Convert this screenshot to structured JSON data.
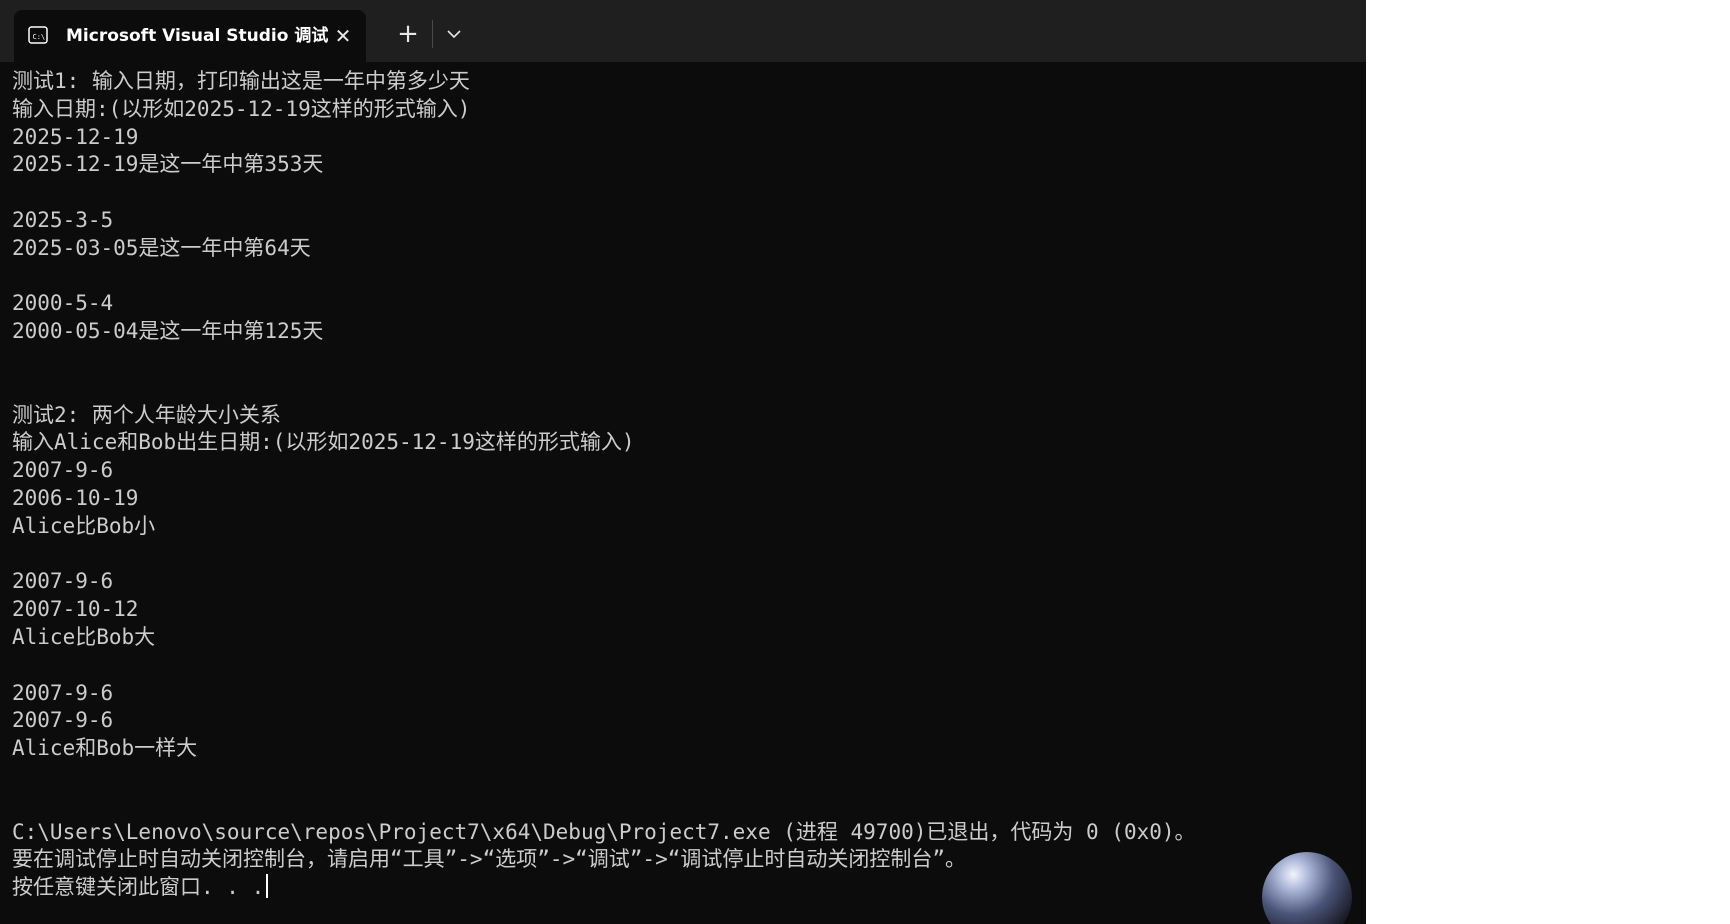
{
  "tab": {
    "title": "Microsoft Visual Studio 调试控",
    "icon": "console-icon",
    "close_glyph": "✕"
  },
  "new_tab_glyph": "+",
  "console": {
    "lines": [
      "测试1: 输入日期，打印输出这是一年中第多少天",
      "输入日期:(以形如2025-12-19这样的形式输入)",
      "2025-12-19",
      "2025-12-19是这一年中第353天",
      "",
      "2025-3-5",
      "2025-03-05是这一年中第64天",
      "",
      "2000-5-4",
      "2000-05-04是这一年中第125天",
      "",
      "",
      "测试2: 两个人年龄大小关系",
      "输入Alice和Bob出生日期:(以形如2025-12-19这样的形式输入)",
      "2007-9-6",
      "2006-10-19",
      "Alice比Bob小",
      "",
      "2007-9-6",
      "2007-10-12",
      "Alice比Bob大",
      "",
      "2007-9-6",
      "2007-9-6",
      "Alice和Bob一样大",
      "",
      "",
      "C:\\Users\\Lenovo\\source\\repos\\Project7\\x64\\Debug\\Project7.exe (进程 49700)已退出，代码为 0 (0x0)。",
      "要在调试停止时自动关闭控制台，请启用“工具”->“选项”->“调试”->“调试停止时自动关闭控制台”。",
      "按任意键关闭此窗口. . ."
    ]
  },
  "colors": {
    "terminal_bg": "#0c0c0c",
    "tab_strip_bg": "#1f1f1f",
    "text": "#cccccc"
  }
}
